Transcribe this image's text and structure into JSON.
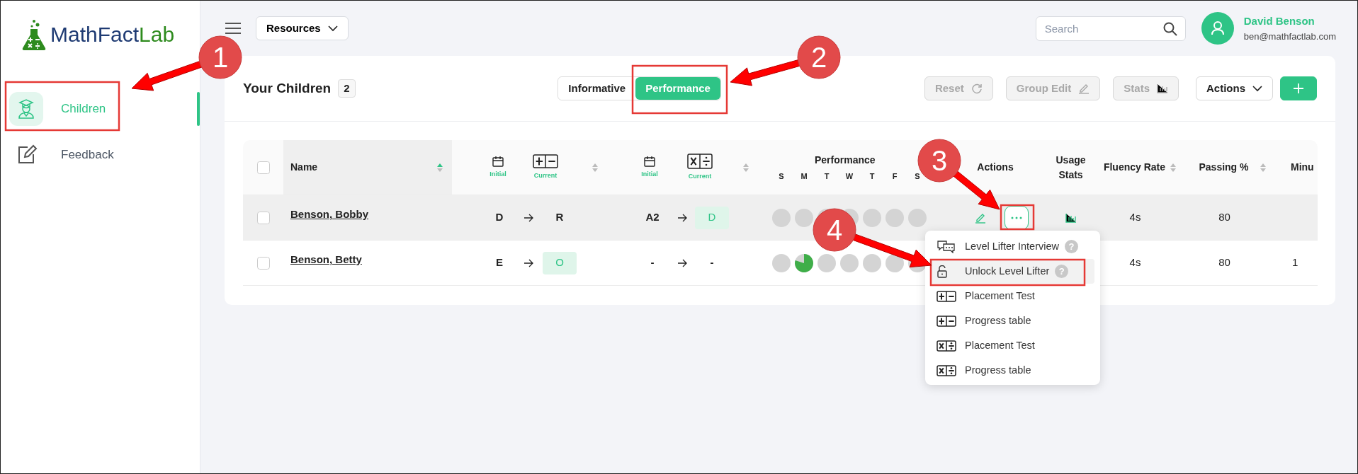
{
  "logo": {
    "main": "MathFact",
    "accent": "Lab"
  },
  "sidebar": {
    "items": [
      {
        "kind": "children",
        "label": "Children",
        "selected": true
      },
      {
        "kind": "feedback",
        "label": "Feedback",
        "selected": false
      }
    ]
  },
  "topbar": {
    "resources": "Resources",
    "search": {
      "placeholder": "Search"
    },
    "user": {
      "name": "David Benson",
      "email": "ben@mathfactlab.com"
    }
  },
  "card": {
    "title": "Your Children",
    "count": "2",
    "view_toggle": [
      {
        "label": "Informative",
        "selected": false
      },
      {
        "label": "Performance",
        "selected": true
      }
    ],
    "toolbar": [
      {
        "kind": "reset",
        "label": "Reset",
        "disabled": true
      },
      {
        "kind": "edit",
        "label": "Group Edit",
        "disabled": true
      },
      {
        "kind": "stats",
        "label": "Stats",
        "disabled": true
      },
      {
        "kind": "menu",
        "label": "Actions",
        "disabled": false
      },
      {
        "kind": "add",
        "disabled": false
      }
    ]
  },
  "table": {
    "select_all": {
      "checked": false
    },
    "columns": [
      {
        "kind": "name",
        "label": "Name",
        "sorted": true
      },
      {
        "kind": "addsub",
        "initial": "Initial",
        "current": "Current",
        "sorted": false
      },
      {
        "kind": "muldiv",
        "initial": "Initial",
        "current": "Current",
        "sorted": false
      },
      {
        "kind": "performance",
        "label": "Performance",
        "days": [
          "S",
          "M",
          "T",
          "W",
          "T",
          "F",
          "S"
        ]
      },
      {
        "kind": "plain",
        "label": "Actions"
      },
      {
        "kind": "plain",
        "label": "Usage Stats"
      },
      {
        "kind": "sortable",
        "label": "Fluency Rate",
        "sorted": false
      },
      {
        "kind": "sortable",
        "label": "Passing %",
        "sorted": false
      },
      {
        "kind": "plain",
        "label": "Minu"
      }
    ],
    "rows": [
      {
        "checked": false,
        "hovered": true,
        "name": "Benson, Bobby",
        "addsub": {
          "initial": "D",
          "current": "R",
          "highlighted": false
        },
        "muldiv": {
          "initial": "A2",
          "current": "D",
          "highlighted": true
        },
        "days": [
          {
            "kind": "empty"
          },
          {
            "kind": "empty"
          },
          {
            "kind": "empty"
          },
          {
            "kind": "empty"
          },
          {
            "kind": "empty"
          },
          {
            "kind": "empty"
          },
          {
            "kind": "empty"
          }
        ],
        "actions_shown": true,
        "usage_shown": true,
        "fluency": "4s",
        "passing": "80"
      },
      {
        "checked": false,
        "hovered": false,
        "name": "Benson, Betty",
        "addsub": {
          "initial": "E",
          "current": "O",
          "highlighted": true
        },
        "muldiv": {
          "initial": "-",
          "current": "-",
          "highlighted": false
        },
        "days": [
          {
            "kind": "empty"
          },
          {
            "kind": "partial"
          },
          {
            "kind": "empty"
          },
          {
            "kind": "empty"
          },
          {
            "kind": "empty"
          },
          {
            "kind": "empty"
          },
          {
            "kind": "empty"
          }
        ],
        "actions_shown": false,
        "usage_shown": false,
        "fluency": "4s",
        "passing": "80",
        "minutes": "1"
      }
    ]
  },
  "action_menu": {
    "items": [
      {
        "kind": "interview",
        "label": "Level Lifter Interview",
        "help": "?",
        "highlighted": false
      },
      {
        "kind": "unlock",
        "label": "Unlock Level Lifter",
        "help": "?",
        "highlighted": true
      },
      {
        "kind": "addsub",
        "label": "Placement Test",
        "highlighted": false
      },
      {
        "kind": "addsub",
        "label": "Progress table",
        "highlighted": false
      },
      {
        "kind": "muldiv",
        "label": "Placement Test",
        "highlighted": false
      },
      {
        "kind": "muldiv",
        "label": "Progress table",
        "highlighted": false
      }
    ]
  },
  "annotations": [
    {
      "number": "1"
    },
    {
      "number": "2"
    },
    {
      "number": "3"
    },
    {
      "number": "4"
    }
  ]
}
